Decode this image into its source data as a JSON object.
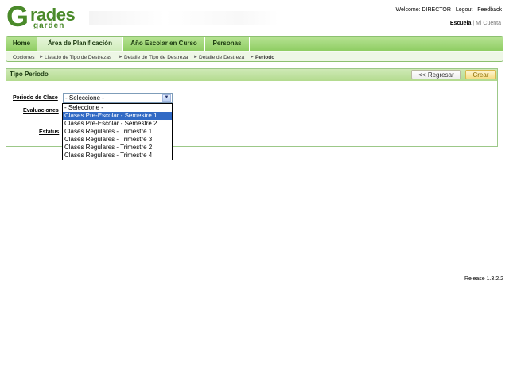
{
  "brand": {
    "logo_letter": "G",
    "logo_word": "rades",
    "logo_sub": "garden"
  },
  "header": {
    "welcome": "Welcome: DIRECTOR",
    "logout": "Logout",
    "feedback": "Feedback",
    "escuela": "Escuela",
    "separator": "|",
    "mi_cuenta": "Mi Cuenta"
  },
  "nav": {
    "tabs": [
      {
        "label": "Home",
        "active": false
      },
      {
        "label": "Área de Planificación",
        "active": true
      },
      {
        "label": "Año Escolar en Curso",
        "active": false
      },
      {
        "label": "Personas",
        "active": false
      }
    ]
  },
  "breadcrumb": [
    "Opciones",
    "Listado de Tipo de Destrezas",
    "Detalle de Tipo de Destreza",
    "Detalle de Destreza",
    "Periodo"
  ],
  "panel": {
    "title": "Tipo Periodo",
    "back_label": "<< Regresar",
    "create_label": "Crear"
  },
  "form": {
    "periodo_label": "Periodo de Clase",
    "evaluaciones_label": "Evaluaciones",
    "estatus_label": "Estatus",
    "select_value": "- Seleccione -",
    "options": [
      "- Seleccione -",
      "Clases Pre-Escolar - Semestre 1",
      "Clases Pre-Escolar - Semestre 2",
      "Clases Regulares - Trimestre 1",
      "Clases Regulares - Trimestre 3",
      "Clases Regulares - Trimestre 2",
      "Clases Regulares - Trimestre 4"
    ],
    "highlighted_option": "Clases Pre-Escolar - Semestre 1"
  },
  "footer": {
    "release": "Release 1.3.2.2"
  },
  "colors": {
    "brand_green": "#4a8a2a",
    "tab_green": "#8fcd63",
    "selection_blue": "#316ac5"
  },
  "icons": {
    "dropdown_arrow": "chevron-down-icon",
    "logo_arrow": "arrow-left-icon"
  }
}
